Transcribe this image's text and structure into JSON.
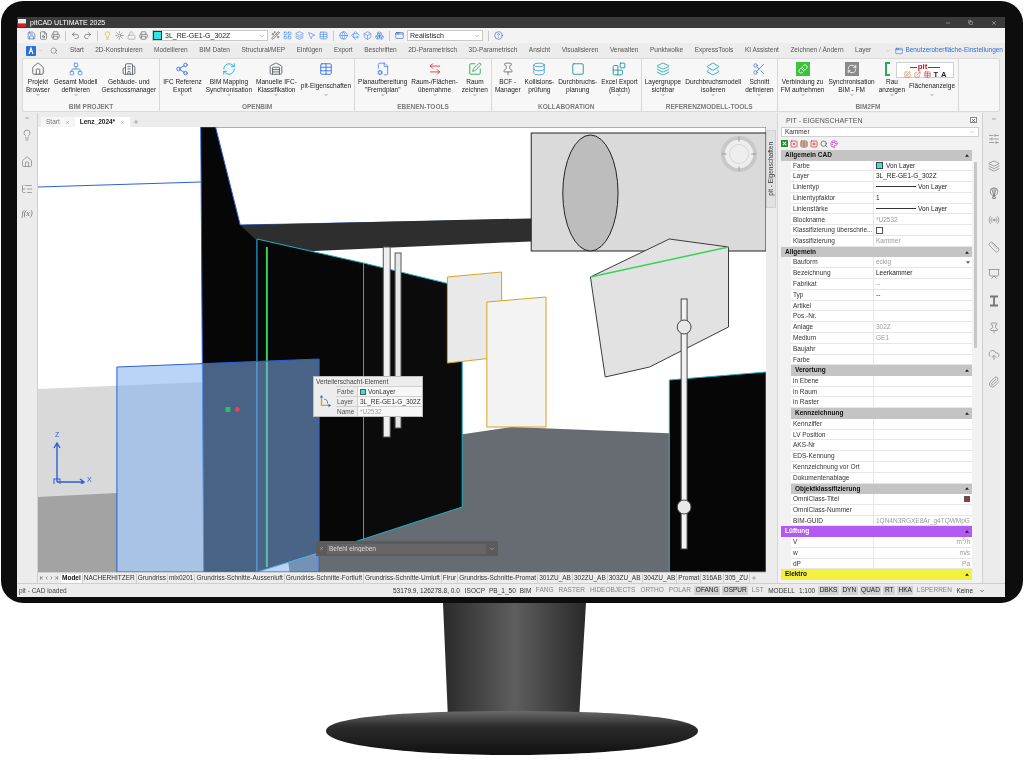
{
  "window": {
    "title": "pitCAD ULTIMATE 2025"
  },
  "quick_access": {
    "layer": "3L_RE-GE1-G_302Z",
    "visual_style": "Realistisch"
  },
  "ribbon_tabs": [
    "Start",
    "2D-Konstruieren",
    "Modellieren",
    "BIM Daten",
    "Structural/MEP",
    "Einfügen",
    "Export",
    "Beschriften",
    "2D-Parametrisch",
    "3D-Parametrisch",
    "Ansicht",
    "Visualisieren",
    "Verwalten",
    "Punktwolke",
    "ExpressTools",
    "KI Assistent",
    "Zeichnen / Ändern",
    "Layer"
  ],
  "ui_settings_link": "Benutzeroberfläche-Einstellungen",
  "ribbon_groups": [
    {
      "title": "BIM PROJEKT",
      "buttons": [
        {
          "lines": [
            "Projekt",
            "Browser"
          ],
          "dropdown": true
        },
        {
          "lines": [
            "Gesamt Modell",
            "definieren"
          ],
          "dropdown": true
        },
        {
          "lines": [
            "Gebäude- und",
            "Geschossmanager"
          ],
          "dropdown": false
        }
      ]
    },
    {
      "title": "OPENBIM",
      "buttons": [
        {
          "lines": [
            "IFC Referenz",
            "Export"
          ],
          "dropdown": true
        },
        {
          "lines": [
            "BIM Mapping",
            "Synchronisation"
          ],
          "dropdown": true
        },
        {
          "lines": [
            "Manuelle IFC-",
            "Klassifikation"
          ],
          "dropdown": true
        },
        {
          "lines": [
            "pit-Eigenschaften"
          ],
          "dropdown": true
        }
      ]
    },
    {
      "title": "EBENEN-TOOLS",
      "buttons": [
        {
          "lines": [
            "Planaufbereitung",
            "\"Fremdplan\""
          ],
          "dropdown": true
        },
        {
          "lines": [
            "Raum-/Flächen-",
            "übernahme"
          ],
          "dropdown": true
        },
        {
          "lines": [
            "Raum",
            "zeichnen"
          ],
          "dropdown": true
        }
      ]
    },
    {
      "title": "KOLLABORATION",
      "buttons": [
        {
          "lines": [
            "BCF -",
            "Manager"
          ],
          "dropdown": false
        },
        {
          "lines": [
            "Kollisions-",
            "prüfung"
          ],
          "dropdown": false
        },
        {
          "lines": [
            "Durchbruchs-",
            "planung"
          ],
          "dropdown": false
        },
        {
          "lines": [
            "Excel Export",
            "(Batch)"
          ],
          "dropdown": true
        }
      ]
    },
    {
      "title": "REFERENZMODELL-TOOLS",
      "buttons": [
        {
          "lines": [
            "Layergruppe",
            "sichtbar"
          ],
          "dropdown": true
        },
        {
          "lines": [
            "Durchbruchsmodell",
            "isolieren"
          ],
          "dropdown": true
        },
        {
          "lines": [
            "Schnitt",
            "definieren"
          ],
          "dropdown": true
        }
      ]
    },
    {
      "title": "BIM2FM",
      "buttons": [
        {
          "lines": [
            "Verbindung zu",
            "FM aufnehmen"
          ],
          "dropdown": true
        },
        {
          "lines": [
            "Synchronisation",
            "BIM - FM"
          ],
          "dropdown": true
        },
        {
          "lines": [
            "Rau",
            "anzeigen"
          ],
          "dropdown": true
        },
        {
          "lines": [
            "Flächenanzeige"
          ],
          "dropdown": true
        }
      ]
    }
  ],
  "pit_popup": {
    "logo": "pit",
    "glyph_buttons": [
      "T",
      "A"
    ]
  },
  "left_sidebar": {
    "formula_button": "f(x)"
  },
  "doc_tabs": [
    {
      "label": "Start",
      "selected": false
    },
    {
      "label": "Lenz_2024*",
      "selected": true
    }
  ],
  "viewport": {
    "tooltip": {
      "title": "Verteilerschacht-Element",
      "rows": [
        {
          "label": "Farbe",
          "value": "VonLayer",
          "kind": "swatch"
        },
        {
          "label": "Layer",
          "value": "3L_RE-GE1-G_302Z",
          "kind": "text"
        },
        {
          "label": "Name",
          "value": "*U2532",
          "kind": "muted"
        }
      ]
    },
    "ucs_labels": [
      "Z",
      "X"
    ],
    "command_line": {
      "placeholder": "Befehl eingeben"
    }
  },
  "layout_tabs": [
    {
      "label": "Model",
      "selected": true
    },
    {
      "label": "NACHERHITZER",
      "selected": false
    },
    {
      "label": "Grundriss",
      "selected": false
    },
    {
      "label": "mlx0201",
      "selected": false
    },
    {
      "label": "Grundriss-Schnitte-Aussenluft",
      "selected": false
    },
    {
      "label": "Grundriss-Schnitte-Fortluft",
      "selected": false
    },
    {
      "label": "Grundriss-Schnitte-Umluft",
      "selected": false
    },
    {
      "label": "Flrur",
      "selected": false
    },
    {
      "label": "Grundriss-Schnitte-Promat",
      "selected": false
    },
    {
      "label": "301ZU_AB",
      "selected": false
    },
    {
      "label": "302ZU_AB",
      "selected": false
    },
    {
      "label": "303ZU_AB",
      "selected": false
    },
    {
      "label": "304ZU_AB",
      "selected": false
    },
    {
      "label": "Promat",
      "selected": false
    },
    {
      "label": "316AB",
      "selected": false
    },
    {
      "label": "305_ZU",
      "selected": false
    }
  ],
  "properties": {
    "title": "PIT - EIGENSCHAFTEN",
    "side_tab": "pit - Eigenschaften",
    "selection": "Kammer",
    "groups": [
      {
        "title": "Allgemein CAD",
        "color": "#c4c4c4",
        "expanded": true,
        "rows": [
          {
            "label": "Farbe",
            "value": "Von Layer",
            "kind": "swatch"
          },
          {
            "label": "Layer",
            "value": "3L_RE-GE1-G_302Z",
            "kind": "text"
          },
          {
            "label": "Linientyp",
            "value": "Von Layer",
            "kind": "linetype"
          },
          {
            "label": "Linientypfaktor",
            "value": "1",
            "kind": "text"
          },
          {
            "label": "Linienstärke",
            "value": "Von Layer",
            "kind": "linetype"
          },
          {
            "label": "Blockname",
            "value": "*U2532",
            "kind": "muted"
          },
          {
            "label": "Klassifizierung überschrie...",
            "kind": "checkbox",
            "checked": false
          },
          {
            "label": "Klassifizierung",
            "value": "Kammer",
            "kind": "muted"
          }
        ]
      },
      {
        "title": "Allgemein",
        "color": "#c4c4c4",
        "expanded": true,
        "rows": [
          {
            "label": "Bauform",
            "value": "eckig",
            "kind": "select"
          },
          {
            "label": "Bezeichnung",
            "value": "Leerkammer",
            "kind": "text"
          },
          {
            "label": "Fabrikat",
            "value": "--",
            "kind": "muted"
          },
          {
            "label": "Typ",
            "value": "--",
            "kind": "text"
          },
          {
            "label": "Artikel",
            "kind": "text"
          },
          {
            "label": "Pos.-Nr.",
            "kind": "text"
          },
          {
            "label": "Anlage",
            "value": "302Z",
            "kind": "muted"
          },
          {
            "label": "Medium",
            "value": "GE1",
            "kind": "muted"
          },
          {
            "label": "Baujahr",
            "kind": "text"
          },
          {
            "label": "Farbe",
            "kind": "text"
          }
        ],
        "children": [
          {
            "title": "Verortung",
            "color": "#c4c4c4",
            "expanded": true,
            "rows": [
              {
                "label": "in Ebene",
                "kind": "text"
              },
              {
                "label": "in Raum",
                "kind": "text"
              },
              {
                "label": "in Raster",
                "kind": "text"
              }
            ]
          },
          {
            "title": "Kennzeichnung",
            "color": "#c4c4c4",
            "expanded": true,
            "rows": [
              {
                "label": "Kennziffer",
                "kind": "text"
              },
              {
                "label": "LV Position",
                "kind": "text"
              },
              {
                "label": "AKS-Nr",
                "kind": "text"
              },
              {
                "label": "EDS-Kennung",
                "kind": "text"
              },
              {
                "label": "Kennzeichnung vor Ort",
                "kind": "text"
              },
              {
                "label": "Dokumentenablage",
                "kind": "text"
              }
            ]
          },
          {
            "title": "Objektklassifizierung",
            "color": "#c4c4c4",
            "expanded": true,
            "rows": [
              {
                "label": "OmniClass-Titel",
                "kind": "action"
              },
              {
                "label": "OmniClass-Nummer",
                "kind": "text"
              },
              {
                "label": "BIM-GUID",
                "value": "1QN4N3RGXE8Ar_g4TQWMpG",
                "kind": "muted"
              }
            ]
          }
        ]
      },
      {
        "title": "Lüftung",
        "color": "#b25af2",
        "expanded": true,
        "rows": [
          {
            "label": "V",
            "value": "m$^{3}$/h",
            "kind": "unit"
          },
          {
            "label": "w",
            "value": "m/s",
            "kind": "unit"
          },
          {
            "label": "dP",
            "value": "Pa",
            "kind": "unit"
          }
        ]
      },
      {
        "title": "Elektro",
        "color": "#f2f23c",
        "expanded": true
      }
    ]
  },
  "status_bar": {
    "message": "pit - CAD loaded",
    "items": [
      {
        "label": "53179.9, 126278.8, 0.0",
        "kind": "coordinates"
      },
      {
        "label": "ISOCP",
        "kind": "text"
      },
      {
        "label": "PB_1_50",
        "kind": "text"
      },
      {
        "label": "BIM",
        "kind": "text"
      },
      {
        "label": "FANG",
        "kind": "toggle",
        "on": false
      },
      {
        "label": "RASTER",
        "kind": "toggle",
        "on": false
      },
      {
        "label": "HIDEOBJECTS",
        "kind": "toggle",
        "on": false
      },
      {
        "label": "ORTHO",
        "kind": "toggle",
        "on": false
      },
      {
        "label": "POLAR",
        "kind": "toggle",
        "on": false
      },
      {
        "label": "OFANG",
        "kind": "toggle",
        "on": true
      },
      {
        "label": "OSPUR",
        "kind": "toggle",
        "on": true
      },
      {
        "label": "LST",
        "kind": "toggle",
        "on": false
      },
      {
        "label": "MODELL",
        "kind": "text"
      },
      {
        "label": "1:100",
        "kind": "text"
      },
      {
        "label": "DBKS",
        "kind": "toggle",
        "on": true
      },
      {
        "label": "DYN",
        "kind": "toggle",
        "on": true
      },
      {
        "label": "QUAD",
        "kind": "toggle",
        "on": true
      },
      {
        "label": "RT",
        "kind": "toggle",
        "on": true
      },
      {
        "label": "HKA",
        "kind": "toggle",
        "on": true
      },
      {
        "label": "LSPERREN",
        "kind": "toggle",
        "on": false
      },
      {
        "label": "Keine",
        "kind": "text"
      }
    ]
  }
}
